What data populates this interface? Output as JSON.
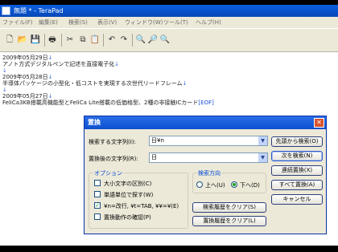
{
  "window": {
    "title": "無題 * - TeraPad"
  },
  "menu": [
    "ファイル(F)",
    "編集(E)",
    "検索(S)",
    "表示(V)",
    "ウィンドウ(W)",
    "ツール(T)",
    "ヘルプ(H)"
  ],
  "editor": {
    "lines": [
      "2009年05月29日",
      "アノト方式デジタルペンで記述を直接電子化",
      "",
      "2009年05月28日",
      "半導体パッケージの小型化・低コストを実現する次世代リードフレーム",
      "",
      "2009年05月27日",
      "FeliCa3KB搭載高機能型とFeliCa Lite搭載の低価格型、2種の非接触ICカード"
    ],
    "eol_mark": "↓",
    "eof_mark": "[EOF]"
  },
  "dialog": {
    "title": "置換",
    "find_label": "検索する文字列(I):",
    "find_value": "日¥n",
    "replace_label": "置換後の文字列(R):",
    "replace_value": "日",
    "options_title": "オプション",
    "options": [
      {
        "label": "大小文字の区別(C)",
        "checked": false
      },
      {
        "label": "単語単位で探す(W)",
        "checked": false
      },
      {
        "label": "¥n=改行, ¥t=TAB, ¥¥=¥(E)",
        "checked": true
      },
      {
        "label": "置換動作の確認(P)",
        "checked": false
      }
    ],
    "direction_title": "検索方向",
    "direction_up": "上へ(U)",
    "direction_down": "下へ(D)",
    "clear_find_history": "検索履歴をクリア(S)",
    "clear_replace_history": "置換履歴をクリア(L)",
    "buttons": {
      "from_start": "先頭から検索(O)",
      "find_next": "次を検索(N)",
      "continuous_replace": "連続置換(X)",
      "replace_all": "すべて置換(A)",
      "cancel": "キャンセル"
    }
  }
}
